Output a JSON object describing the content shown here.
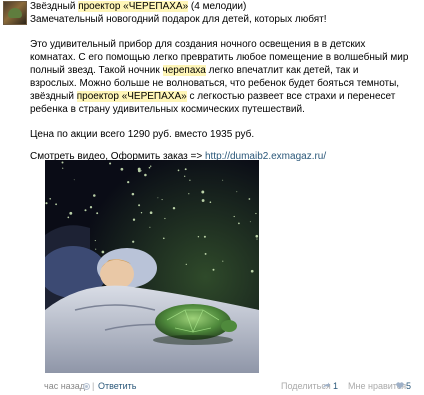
{
  "post": {
    "title_before": "Звёздный ",
    "title_highlight": "проектор «ЧЕРЕПАХА»",
    "title_after": " (4 мелодии)",
    "subtitle": "Замечательный новогодний подарок для детей, которых любят!",
    "p1_l1": "Это удивительный прибор для создания ночного освещения в в детских",
    "p1_l2": "комнатах. С его помощью легко превратить любое помещение в волшебный мир",
    "p1_l3_before": "полный звезд. Такой ночник ",
    "p1_l3_highlight": "черепаха",
    "p1_l3_after": " легко впечатлит как детей, так и",
    "p1_l4": "взрослых. Можно больше не волноваться, что ребенок будет бояться темноты,",
    "p1_l5_before": "звёздный ",
    "p1_l5_highlight": "проектор «ЧЕРЕПАХА»",
    "p1_l5_after": " с легкостью развеет все страхи и перенесет",
    "p1_l6": "ребенка в страну удивительных космических путешествий.",
    "price": "Цена по акции всего 1290 руб. вместо 1935 руб.",
    "video_text": "Смотреть видео, Оформить заказ => ",
    "video_link": "http://dumaib2.exmagaz.ru/"
  },
  "footer": {
    "time": "час назад",
    "separator": "|",
    "reply": "Ответить",
    "share_label": "Поделиться",
    "share_count": "1",
    "like_label": "Мне нравится",
    "like_count": "5"
  },
  "colors": {
    "link": "#2b587a",
    "highlight": "#fff6b8",
    "muted": "#888888"
  },
  "icons": [
    "share-icon",
    "heart-icon",
    "comment-bubble-icon"
  ]
}
